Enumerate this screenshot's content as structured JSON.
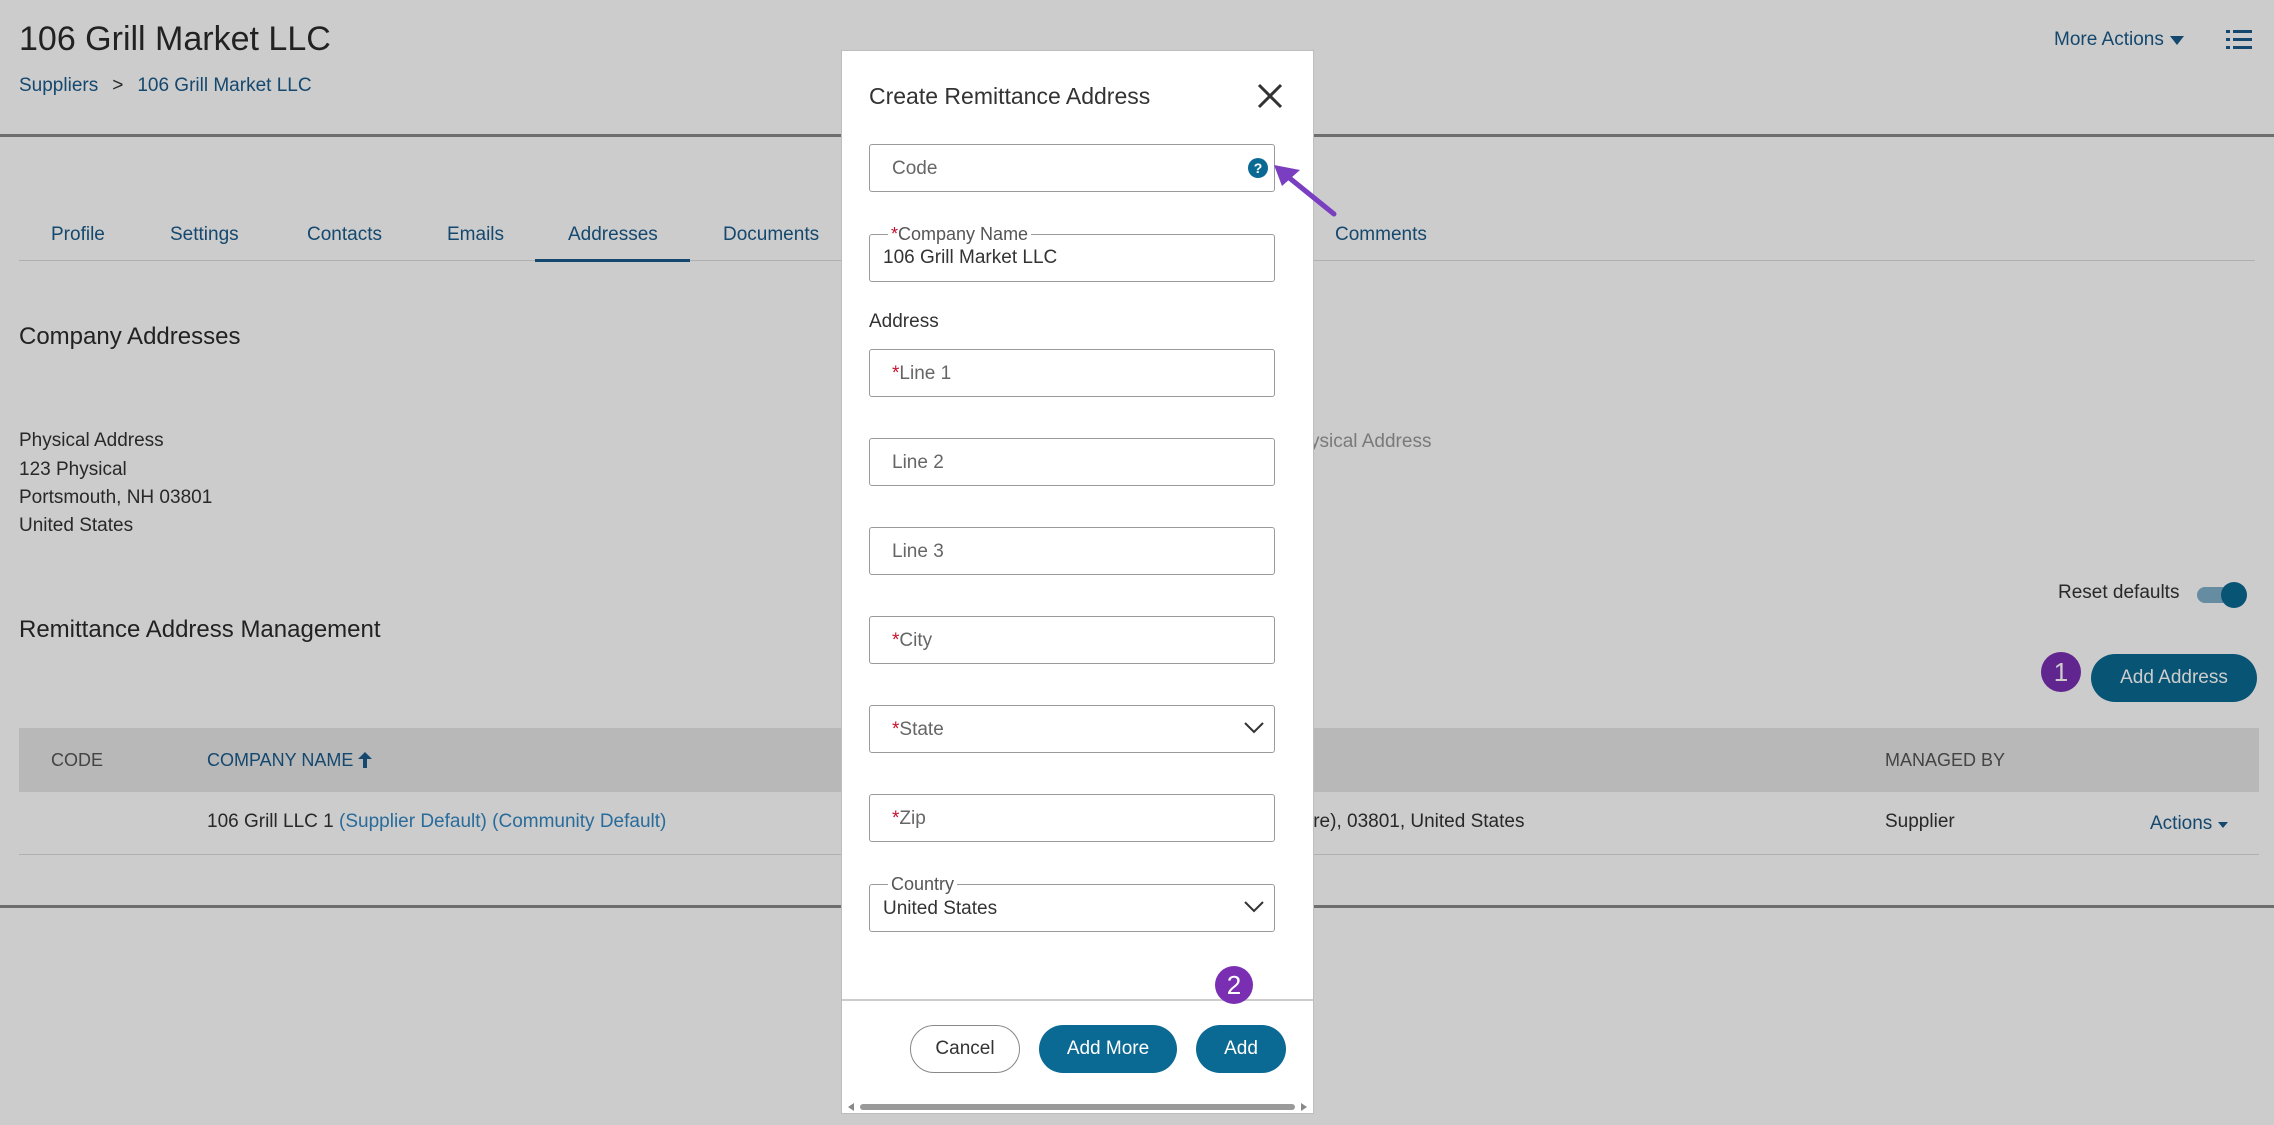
{
  "header": {
    "title": "106 Grill Market LLC",
    "breadcrumb": [
      "Suppliers",
      ">",
      "106 Grill Market LLC"
    ],
    "more_actions": "More Actions"
  },
  "tabs": [
    "Profile",
    "Settings",
    "Contacts",
    "Emails",
    "Addresses",
    "Documents",
    "Comments"
  ],
  "active_tab": "Addresses",
  "company_addresses": {
    "title": "Company Addresses",
    "physical": {
      "label": "Physical Address",
      "lines": [
        "123 Physical",
        "Portsmouth, NH 03801",
        "United States"
      ]
    },
    "partial_label": "ysical Address"
  },
  "remittance": {
    "title": "Remittance Address Management",
    "reset_defaults": "Reset defaults",
    "add_address": "Add Address",
    "badge": "1",
    "columns": [
      "CODE",
      "COMPANY NAME",
      "MANAGED BY"
    ],
    "row": {
      "company": "106 Grill LLC 1",
      "supplier_default": "(Supplier Default)",
      "community_default": "(Community Default)",
      "address_partial": "ire), 03801, United States",
      "managed_by": "Supplier",
      "actions": "Actions"
    }
  },
  "modal": {
    "title": "Create Remittance Address",
    "code_placeholder": "Code",
    "company_name_label": "Company Name",
    "company_name_value": "106 Grill Market LLC",
    "address_label": "Address",
    "required_mark": "*",
    "line1": "Line 1",
    "line2": "Line 2",
    "line3": "Line 3",
    "city": "City",
    "state": "State",
    "zip": "Zip",
    "country_label": "Country",
    "country_value": "United States",
    "badge": "2",
    "cancel": "Cancel",
    "add_more": "Add More",
    "add": "Add"
  },
  "colors": {
    "primary": "#0b6a93",
    "link": "#1a5a8a",
    "badge": "#7a2fb3",
    "required": "#c8102e",
    "annotation_arrow": "#7a3fc0"
  }
}
